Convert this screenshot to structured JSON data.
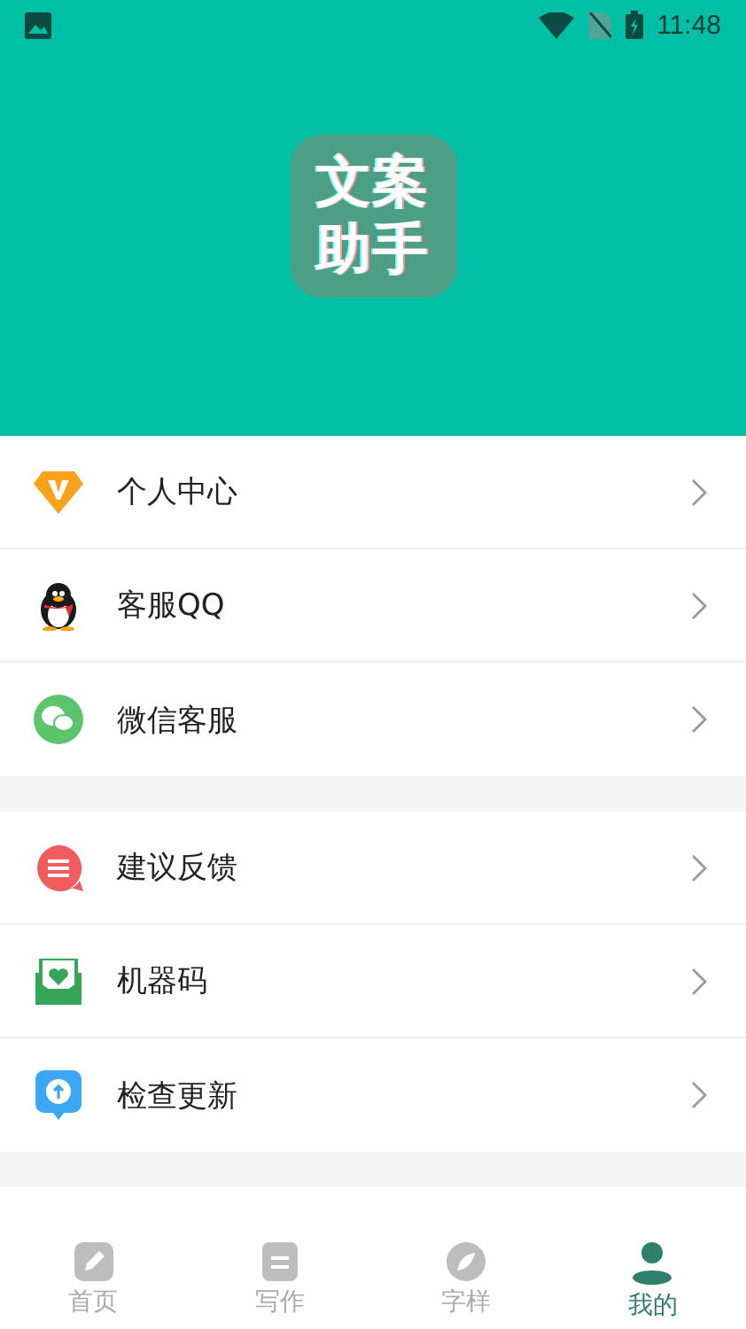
{
  "status_bar": {
    "time": "11:48"
  },
  "header": {
    "logo_lines": [
      "文案",
      "助手"
    ]
  },
  "menu_groups": [
    {
      "items": [
        {
          "label": "个人中心"
        },
        {
          "label": "客服QQ"
        },
        {
          "label": "微信客服"
        }
      ]
    },
    {
      "items": [
        {
          "label": "建议反馈"
        },
        {
          "label": "机器码"
        },
        {
          "label": "检查更新"
        }
      ]
    }
  ],
  "bottom_nav": [
    {
      "label": "首页",
      "selected": false
    },
    {
      "label": "写作",
      "selected": false
    },
    {
      "label": "字样",
      "selected": false
    },
    {
      "label": "我的",
      "selected": true
    }
  ]
}
